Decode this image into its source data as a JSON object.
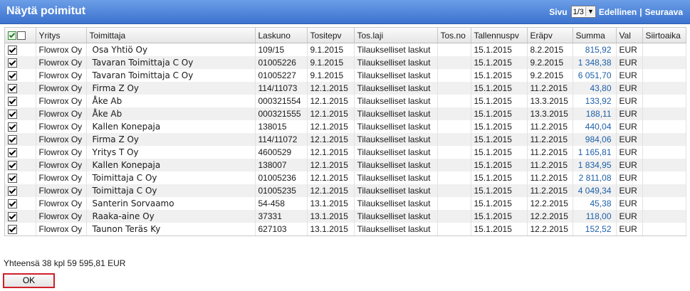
{
  "header": {
    "title": "Näytä poimitut",
    "page_label": "Sivu",
    "page_select": "1/3",
    "prev_label": "Edellinen",
    "separator": "|",
    "next_label": "Seuraava"
  },
  "table": {
    "columns": [
      "Yritys",
      "Toimittaja",
      "Laskuno",
      "Tositepv",
      "Tos.laji",
      "Tos.no",
      "Tallennuspv",
      "Eräpv",
      "Summa",
      "Val",
      "Siirtoaika"
    ],
    "rows": [
      {
        "checked": true,
        "yritys": "Flowrox Oy",
        "toimittaja": "Osa Yhtiö Oy",
        "laskuno": "109/15",
        "tositepv": "9.1.2015",
        "toslaji": "Tilaukselliset laskut",
        "tosno": "",
        "tallennuspv": "15.1.2015",
        "erapv": "8.2.2015",
        "summa": "815,92",
        "val": "EUR",
        "siirtoaika": ""
      },
      {
        "checked": true,
        "yritys": "Flowrox Oy",
        "toimittaja": "Tavaran Toimittaja C Oy",
        "laskuno": "01005226",
        "tositepv": "9.1.2015",
        "toslaji": "Tilaukselliset laskut",
        "tosno": "",
        "tallennuspv": "15.1.2015",
        "erapv": "9.2.2015",
        "summa": "1 348,38",
        "val": "EUR",
        "siirtoaika": ""
      },
      {
        "checked": true,
        "yritys": "Flowrox Oy",
        "toimittaja": "Tavaran Toimittaja C Oy",
        "laskuno": "01005227",
        "tositepv": "9.1.2015",
        "toslaji": "Tilaukselliset laskut",
        "tosno": "",
        "tallennuspv": "15.1.2015",
        "erapv": "9.2.2015",
        "summa": "6 051,70",
        "val": "EUR",
        "siirtoaika": ""
      },
      {
        "checked": true,
        "yritys": "Flowrox Oy",
        "toimittaja": "Firma Z Oy",
        "laskuno": "114/11073",
        "tositepv": "12.1.2015",
        "toslaji": "Tilaukselliset laskut",
        "tosno": "",
        "tallennuspv": "15.1.2015",
        "erapv": "11.2.2015",
        "summa": "43,80",
        "val": "EUR",
        "siirtoaika": ""
      },
      {
        "checked": true,
        "yritys": "Flowrox Oy",
        "toimittaja": "Åke Ab",
        "laskuno": "000321554",
        "tositepv": "12.1.2015",
        "toslaji": "Tilaukselliset laskut",
        "tosno": "",
        "tallennuspv": "15.1.2015",
        "erapv": "13.3.2015",
        "summa": "133,92",
        "val": "EUR",
        "siirtoaika": ""
      },
      {
        "checked": true,
        "yritys": "Flowrox Oy",
        "toimittaja": "Åke Ab",
        "laskuno": "000321555",
        "tositepv": "12.1.2015",
        "toslaji": "Tilaukselliset laskut",
        "tosno": "",
        "tallennuspv": "15.1.2015",
        "erapv": "13.3.2015",
        "summa": "188,11",
        "val": "EUR",
        "siirtoaika": ""
      },
      {
        "checked": true,
        "yritys": "Flowrox Oy",
        "toimittaja": "Kallen Konepaja",
        "laskuno": "138015",
        "tositepv": "12.1.2015",
        "toslaji": "Tilaukselliset laskut",
        "tosno": "",
        "tallennuspv": "15.1.2015",
        "erapv": "11.2.2015",
        "summa": "440,04",
        "val": "EUR",
        "siirtoaika": ""
      },
      {
        "checked": true,
        "yritys": "Flowrox Oy",
        "toimittaja": "Firma Z Oy",
        "laskuno": "114/11072",
        "tositepv": "12.1.2015",
        "toslaji": "Tilaukselliset laskut",
        "tosno": "",
        "tallennuspv": "15.1.2015",
        "erapv": "11.2.2015",
        "summa": "984,06",
        "val": "EUR",
        "siirtoaika": ""
      },
      {
        "checked": true,
        "yritys": "Flowrox Oy",
        "toimittaja": "Yritys T Oy",
        "laskuno": "4600529",
        "tositepv": "12.1.2015",
        "toslaji": "Tilaukselliset laskut",
        "tosno": "",
        "tallennuspv": "15.1.2015",
        "erapv": "11.2.2015",
        "summa": "1 165,81",
        "val": "EUR",
        "siirtoaika": ""
      },
      {
        "checked": true,
        "yritys": "Flowrox Oy",
        "toimittaja": "Kallen Konepaja",
        "laskuno": "138007",
        "tositepv": "12.1.2015",
        "toslaji": "Tilaukselliset laskut",
        "tosno": "",
        "tallennuspv": "15.1.2015",
        "erapv": "11.2.2015",
        "summa": "1 834,95",
        "val": "EUR",
        "siirtoaika": ""
      },
      {
        "checked": true,
        "yritys": "Flowrox Oy",
        "toimittaja": "Toimittaja C Oy",
        "laskuno": "01005236",
        "tositepv": "12.1.2015",
        "toslaji": "Tilaukselliset laskut",
        "tosno": "",
        "tallennuspv": "15.1.2015",
        "erapv": "11.2.2015",
        "summa": "2 811,08",
        "val": "EUR",
        "siirtoaika": ""
      },
      {
        "checked": true,
        "yritys": "Flowrox Oy",
        "toimittaja": "Toimittaja C Oy",
        "laskuno": "01005235",
        "tositepv": "12.1.2015",
        "toslaji": "Tilaukselliset laskut",
        "tosno": "",
        "tallennuspv": "15.1.2015",
        "erapv": "11.2.2015",
        "summa": "4 049,34",
        "val": "EUR",
        "siirtoaika": ""
      },
      {
        "checked": true,
        "yritys": "Flowrox Oy",
        "toimittaja": "Santerin Sorvaamo",
        "laskuno": "54-458",
        "tositepv": "13.1.2015",
        "toslaji": "Tilaukselliset laskut",
        "tosno": "",
        "tallennuspv": "15.1.2015",
        "erapv": "12.2.2015",
        "summa": "45,38",
        "val": "EUR",
        "siirtoaika": ""
      },
      {
        "checked": true,
        "yritys": "Flowrox Oy",
        "toimittaja": "Raaka-aine Oy",
        "laskuno": "37331",
        "tositepv": "13.1.2015",
        "toslaji": "Tilaukselliset laskut",
        "tosno": "",
        "tallennuspv": "15.1.2015",
        "erapv": "12.2.2015",
        "summa": "118,00",
        "val": "EUR",
        "siirtoaika": ""
      },
      {
        "checked": true,
        "yritys": "Flowrox Oy",
        "toimittaja": "Taunon Teräs Ky",
        "laskuno": "627103",
        "tositepv": "13.1.2015",
        "toslaji": "Tilaukselliset laskut",
        "tosno": "",
        "tallennuspv": "15.1.2015",
        "erapv": "12.2.2015",
        "summa": "152,52",
        "val": "EUR",
        "siirtoaika": ""
      }
    ]
  },
  "footer": {
    "total_text": "Yhteensä 38 kpl 59 595,81 EUR",
    "ok_label": "OK"
  }
}
